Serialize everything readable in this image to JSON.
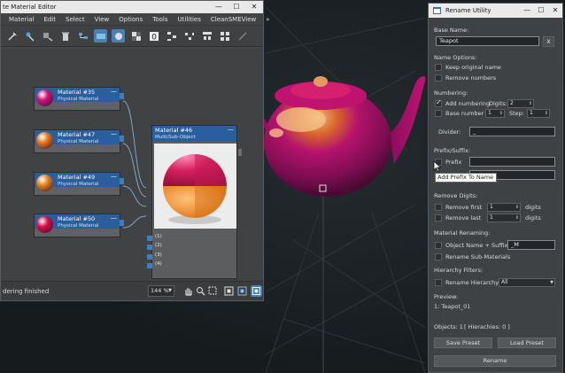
{
  "material_editor": {
    "title": "te Material Editor",
    "controls": {
      "minimize": "—",
      "maximize": "☐",
      "close": "✕"
    },
    "menu": [
      "Material",
      "Edit",
      "Select",
      "View",
      "Options",
      "Tools",
      "Utilities",
      "CleanSMEView"
    ],
    "menu_more": "»",
    "nodes": [
      {
        "name": "Material #35",
        "type": "Physical Material",
        "color": "#d0147e"
      },
      {
        "name": "Material #47",
        "type": "Physical Material",
        "color": "#e77b1e"
      },
      {
        "name": "Material #49",
        "type": "Physical Material",
        "color": "#e7861e"
      },
      {
        "name": "Material #50",
        "type": "Physical Material",
        "color": "#d80f4a"
      }
    ],
    "node_minimize": "—",
    "multi_node": {
      "name": "Material #46",
      "type": "Multi/Sub-Object",
      "slots": [
        "(1)",
        "(2)",
        "(3)",
        "(4)"
      ]
    },
    "status": "dering finished",
    "zoom": "144 %"
  },
  "rename_utility": {
    "title": "Rename Utility",
    "controls": {
      "minimize": "—",
      "maximize": "☐",
      "close": "✕"
    },
    "base_name_label": "Base Name:",
    "base_name_value": "Teapot",
    "clear_label": "X",
    "name_options_label": "Name Options:",
    "keep_original_name": "Keep original name",
    "remove_numbers": "Remove numbers",
    "numbering_label": "Numbering:",
    "add_numbering": "Add numbering",
    "digits_label": "Digits:",
    "digits_value": "2",
    "base_number_label": "Base number",
    "base_number_value": "1",
    "step_label": "Step:",
    "step_value": "1",
    "divider_label": "Divider:",
    "divider_value": "_",
    "prefix_suffix_label": "Prefix/Suffix:",
    "prefix_label": "Prefix",
    "prefix_value": "",
    "suffix_value": "",
    "tooltip": "Add Prefix To Name",
    "remove_digits_label": "Remove Digits:",
    "remove_first_label": "Remove first",
    "remove_first_value": "1",
    "remove_last_label": "Remove last",
    "remove_last_value": "1",
    "digits_unit": "digits",
    "material_renaming_label": "Material Renaming:",
    "object_name_suffix_label": "Object Name + Suffix:",
    "object_name_suffix_value": "_M",
    "rename_sub_materials": "Rename Sub-Materials",
    "hierarchy_filters_label": "Hierarchy Filters:",
    "rename_hierarchy": "Rename Hierarchy",
    "hierarchy_option": "All",
    "preview_label": "Preview:",
    "preview_value": "1: Teapot_01",
    "objects_count": "Objects: 1",
    "hierarchies_count": "[ Hierachies: 0 ]",
    "save_preset": "Save Preset",
    "load_preset": "Load Preset",
    "rename_button": "Rename"
  },
  "colors": {
    "accent_blue": "#2a5f9d",
    "teapot_magenta": "#b0106a",
    "panel_bg": "#3f4245"
  }
}
